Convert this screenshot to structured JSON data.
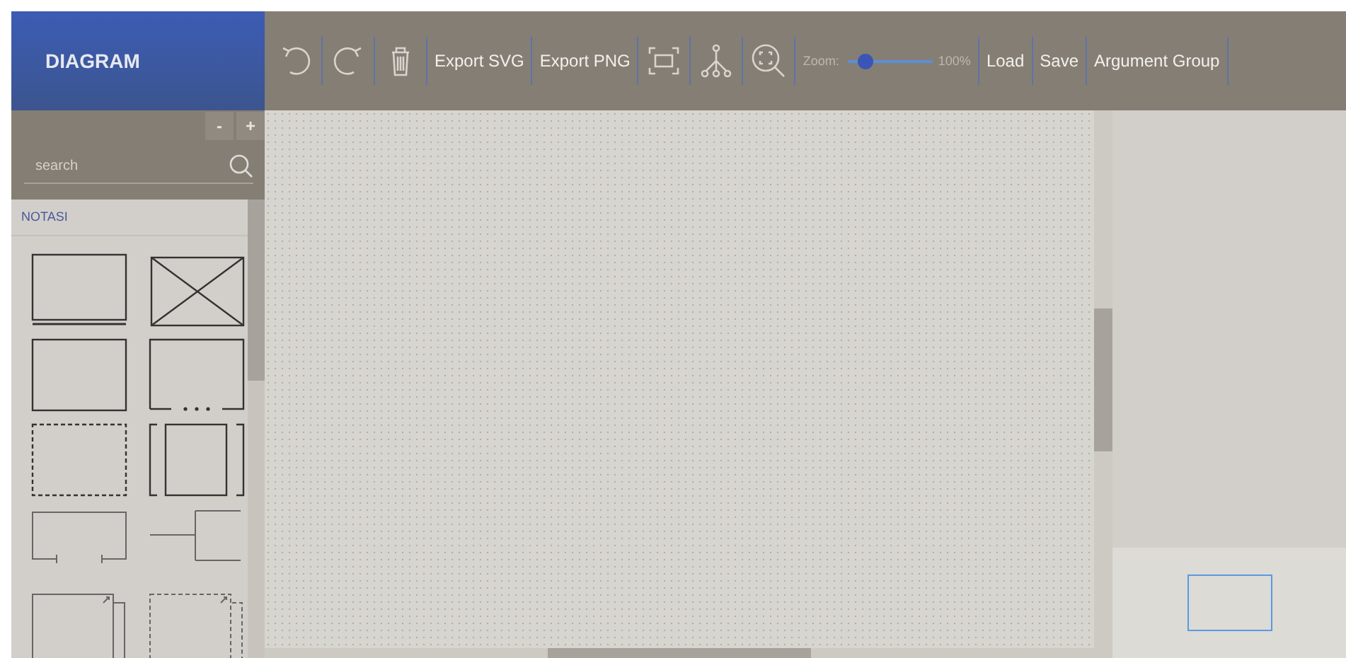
{
  "header": {
    "title": "DIAGRAM"
  },
  "toolbar": {
    "items": [
      {
        "kind": "undo"
      },
      {
        "kind": "redo"
      },
      {
        "kind": "delete"
      },
      {
        "kind": "text",
        "label": "Export SVG"
      },
      {
        "kind": "text",
        "label": "Export PNG"
      },
      {
        "kind": "fit"
      },
      {
        "kind": "layout"
      },
      {
        "kind": "zoom_fit"
      },
      {
        "kind": "zoom",
        "label": "Zoom:",
        "level": 0.2,
        "reading": "100%"
      },
      {
        "kind": "text",
        "label": "Load"
      },
      {
        "kind": "text",
        "label": "Save"
      },
      {
        "kind": "text",
        "label": "Argument Group"
      }
    ]
  },
  "sidebar": {
    "collapse": "-",
    "expand": "+",
    "search": {
      "placeholder": "search"
    },
    "section": "NOTASI",
    "shapes": [
      {
        "kind": "double_bottom"
      },
      {
        "kind": "crossed"
      },
      {
        "kind": "plain"
      },
      {
        "kind": "dotted_bottom"
      },
      {
        "kind": "dashed"
      },
      {
        "kind": "bracketed"
      },
      {
        "kind": "open_bottom"
      },
      {
        "kind": "branch"
      },
      {
        "kind": "stacked"
      },
      {
        "kind": "dashed_stacked"
      }
    ]
  }
}
